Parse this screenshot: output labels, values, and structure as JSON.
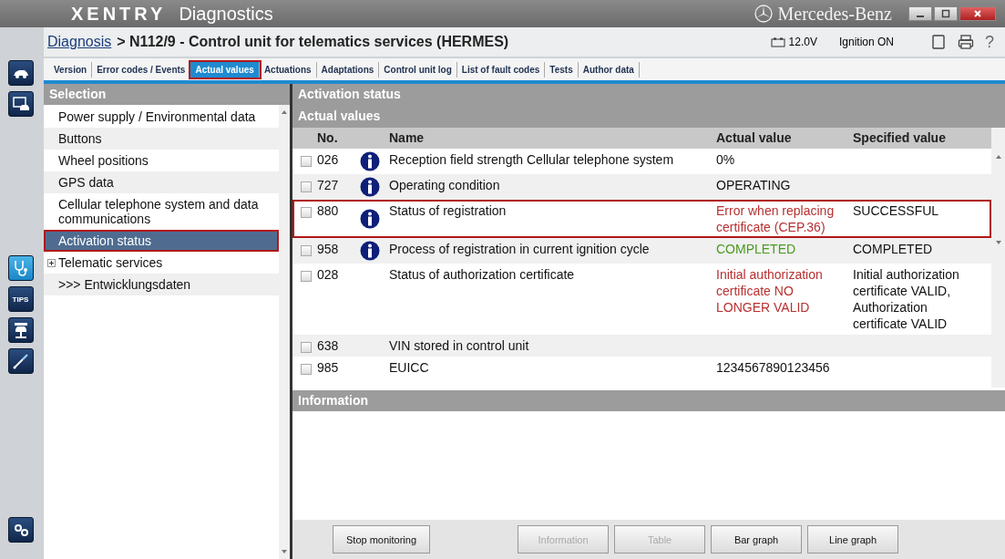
{
  "app_title": {
    "brand": "XENTRY",
    "product": "Diagnostics",
    "maker": "Mercedes-Benz"
  },
  "breadcrumb": {
    "link": "Diagnosis",
    "path": "> N112/9 - Control unit for telematics services (HERMES)"
  },
  "status": {
    "voltage": "12.0V",
    "ignition": "Ignition ON",
    "help": "?"
  },
  "tabs": [
    {
      "label": "Version",
      "selected": false
    },
    {
      "label": "Error codes / Events",
      "selected": false
    },
    {
      "label": "Actual values",
      "selected": true
    },
    {
      "label": "Actuations",
      "selected": false
    },
    {
      "label": "Adaptations",
      "selected": false
    },
    {
      "label": "Control unit log",
      "selected": false
    },
    {
      "label": "List of fault codes",
      "selected": false
    },
    {
      "label": "Tests",
      "selected": false
    },
    {
      "label": "Author data",
      "selected": false
    }
  ],
  "tips_label": "TIPS",
  "selection": {
    "title": "Selection",
    "items": [
      {
        "label": "Power supply / Environmental data",
        "kind": "leaf",
        "selected": false
      },
      {
        "label": "Buttons",
        "kind": "leaf",
        "selected": false
      },
      {
        "label": "Wheel positions",
        "kind": "leaf",
        "selected": false
      },
      {
        "label": "GPS data",
        "kind": "leaf",
        "selected": false
      },
      {
        "label": "Cellular telephone system and data communications",
        "kind": "leaf",
        "selected": false
      },
      {
        "label": "Activation status",
        "kind": "leaf",
        "selected": true
      },
      {
        "label": "Telematic services",
        "kind": "group",
        "expanded": false,
        "selected": false
      },
      {
        "label": ">>> Entwicklungsdaten",
        "kind": "leaf",
        "selected": false
      }
    ]
  },
  "panel": {
    "title": "Activation status",
    "subtitle": "Actual values",
    "columns": [
      "No.",
      "Name",
      "Actual value",
      "Specified value"
    ],
    "rows": [
      {
        "no": "026",
        "name": "Reception field strength Cellular telephone system",
        "actual": "0%",
        "specified": "",
        "info": true,
        "checked": false,
        "selected": false,
        "fault": false,
        "passed": false
      },
      {
        "no": "727",
        "name": "Operating condition",
        "actual": "OPERATING",
        "specified": "",
        "info": true,
        "checked": false,
        "selected": false,
        "fault": false,
        "passed": false
      },
      {
        "no": "880",
        "name": "Status of registration",
        "actual": "Error when replacing certificate (CEP.36)",
        "specified": "SUCCESSFUL",
        "info": true,
        "checked": false,
        "selected": true,
        "fault": true,
        "passed": false
      },
      {
        "no": "958",
        "name": "Process of registration in current ignition cycle",
        "actual": "COMPLETED",
        "specified": "COMPLETED",
        "info": true,
        "checked": false,
        "selected": false,
        "fault": false,
        "passed": true
      },
      {
        "no": "028",
        "name": "Status of authorization certificate",
        "actual": "Initial authorization certificate NO LONGER VALID",
        "specified": "Initial authorization certificate VALID, Authorization certificate VALID",
        "info": false,
        "checked": false,
        "selected": false,
        "fault": true,
        "passed": false
      },
      {
        "no": "638",
        "name": "VIN stored in control unit",
        "actual": "",
        "specified": "",
        "info": false,
        "checked": false,
        "selected": false
      },
      {
        "no": "985",
        "name": "EUICC",
        "actual": "1234567890123456",
        "specified": "",
        "info": false,
        "checked": false,
        "selected": false,
        "fault": false,
        "passed": false
      }
    ]
  },
  "info_panel": {
    "title": "Information"
  },
  "buttons_left": [
    {
      "label": "Stop monitoring",
      "disabled": false
    }
  ],
  "buttons_right": [
    {
      "label": "Information",
      "disabled": true
    },
    {
      "label": "Table",
      "disabled": true
    },
    {
      "label": "Bar graph",
      "disabled": false
    },
    {
      "label": "Line graph",
      "disabled": false
    }
  ]
}
